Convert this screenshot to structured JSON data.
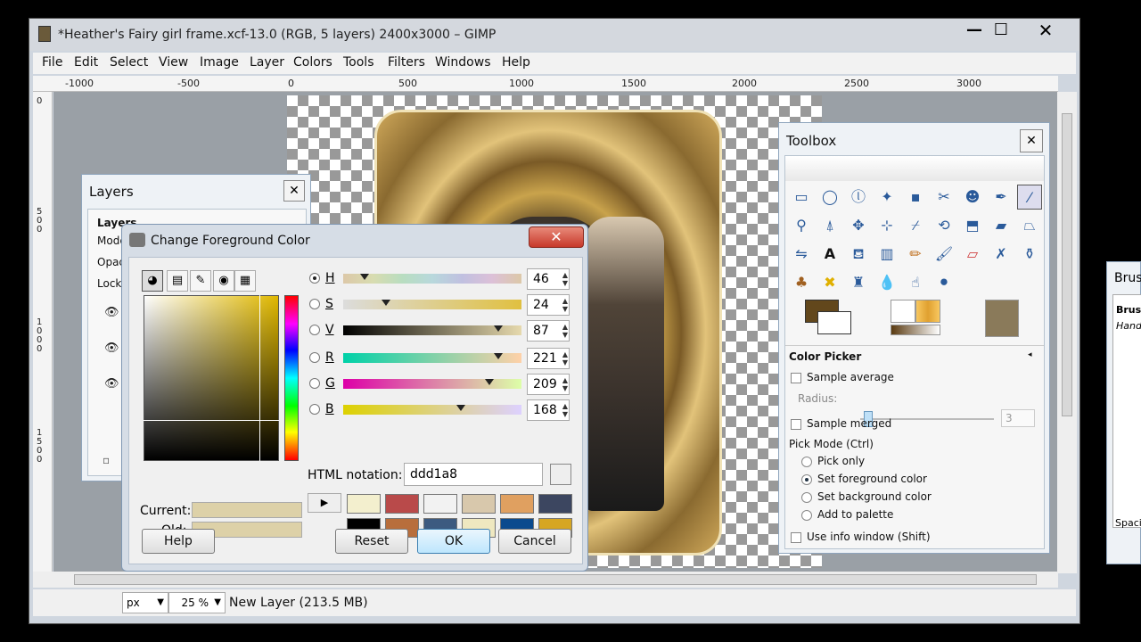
{
  "window": {
    "title": "*Heather's Fairy girl frame.xcf-13.0 (RGB, 5 layers) 2400x3000 – GIMP",
    "controls": {
      "minimize": "—",
      "maximize": "☐",
      "close": "✕"
    }
  },
  "menu": [
    "File",
    "Edit",
    "Select",
    "View",
    "Image",
    "Layer",
    "Colors",
    "Tools",
    "Filters",
    "Windows",
    "Help"
  ],
  "ruler": {
    "top": [
      "-1000",
      "-500",
      "0",
      "500",
      "1000",
      "1500",
      "2000",
      "2500",
      "3000"
    ],
    "left": [
      "0",
      "500",
      "1000",
      "1500"
    ]
  },
  "status": {
    "unit": "px",
    "zoom": "25 %",
    "message": "New Layer (213.5 MB)"
  },
  "layers_dialog": {
    "title": "Layers",
    "labels": [
      "Layers",
      "Mode:",
      "Opaci",
      "Lock:"
    ]
  },
  "color_dialog": {
    "title": "Change Foreground Color",
    "channels": [
      {
        "label": "H",
        "value": "46",
        "fraction": 0.12,
        "selected": true
      },
      {
        "label": "S",
        "value": "24",
        "fraction": 0.24,
        "selected": false
      },
      {
        "label": "V",
        "value": "87",
        "fraction": 0.87,
        "selected": false
      },
      {
        "label": "R",
        "value": "221",
        "fraction": 0.87,
        "selected": false
      },
      {
        "label": "G",
        "value": "209",
        "fraction": 0.82,
        "selected": false
      },
      {
        "label": "B",
        "value": "168",
        "fraction": 0.66,
        "selected": false
      }
    ],
    "html_label": "HTML notation:",
    "html_value": "ddd1a8",
    "current_label": "Current:",
    "old_label": "Old:",
    "current_color": "#ddd1a8",
    "history_colors": [
      "#f3efce",
      "#b94a4a",
      "#f2f2f2",
      "#d8c8ac",
      "#e0a060",
      "#3c4660",
      "#000000",
      "#b86e3c",
      "#3c5a80",
      "#efe8c0",
      "#0a4a8e",
      "#d6a622"
    ],
    "buttons": {
      "help": "Help",
      "reset": "Reset",
      "ok": "OK",
      "cancel": "Cancel"
    }
  },
  "toolbox": {
    "title": "Toolbox",
    "tool_options_title": "Color Picker",
    "sample_average": "Sample average",
    "radius_label": "Radius:",
    "radius_value": "3",
    "sample_merged": "Sample merged",
    "pick_mode_label": "Pick Mode  (Ctrl)",
    "pick_modes": [
      "Pick only",
      "Set foreground color",
      "Set background color",
      "Add to palette"
    ],
    "selected_pick_mode": 1,
    "use_info_window": "Use info window  (Shift)",
    "fg_color": "#62471c"
  },
  "brushes_dock": {
    "title": "Brus",
    "labels": [
      "Brush",
      "Hand",
      "Spaci"
    ]
  }
}
